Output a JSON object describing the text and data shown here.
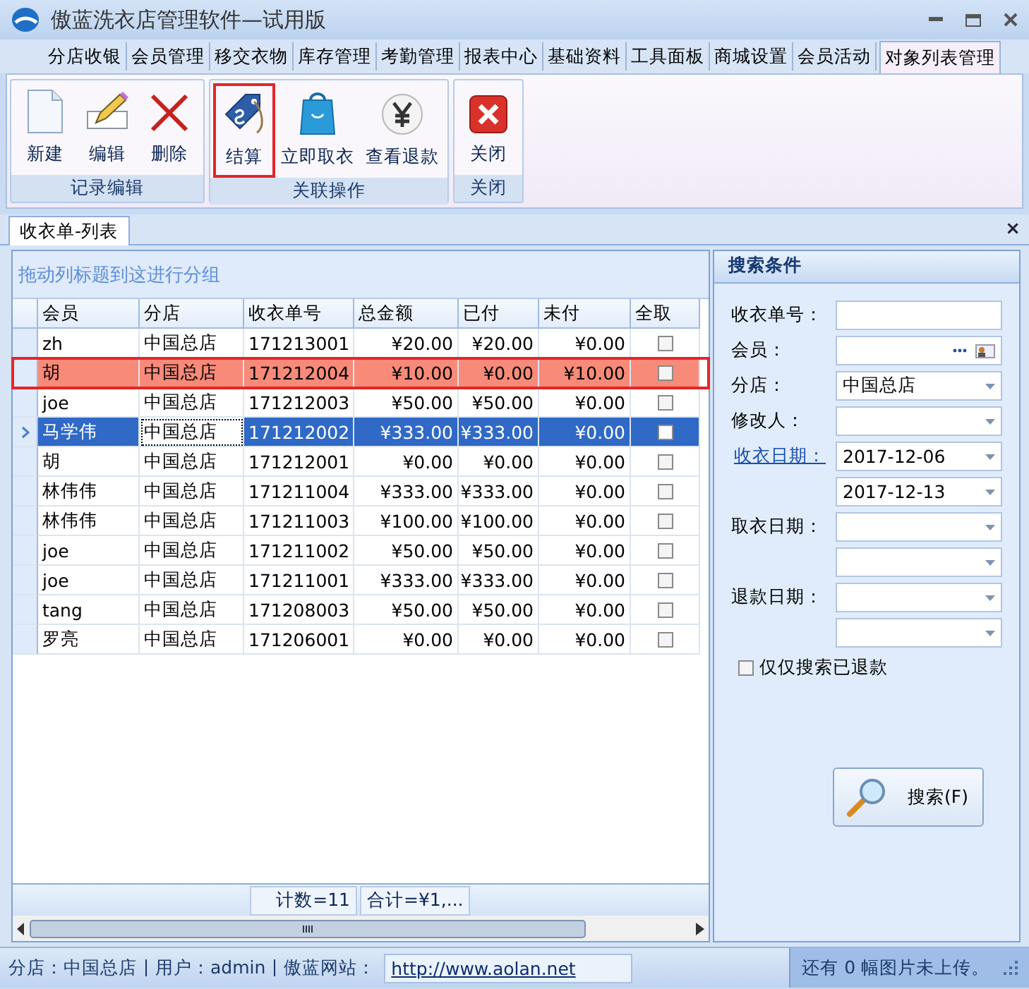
{
  "window": {
    "title": "傲蓝洗衣店管理软件—试用版"
  },
  "menu_tabs": [
    {
      "label": "分店收银",
      "selected": false
    },
    {
      "label": "会员管理",
      "selected": false
    },
    {
      "label": "移交衣物",
      "selected": false
    },
    {
      "label": "库存管理",
      "selected": false
    },
    {
      "label": "考勤管理",
      "selected": false
    },
    {
      "label": "报表中心",
      "selected": false
    },
    {
      "label": "基础资料",
      "selected": false
    },
    {
      "label": "工具面板",
      "selected": false
    },
    {
      "label": "商城设置",
      "selected": false
    },
    {
      "label": "会员活动",
      "selected": false
    },
    {
      "label": "对象列表管理",
      "selected": true
    }
  ],
  "ribbon_groups": [
    {
      "label": "记录编辑",
      "buttons": [
        {
          "label": "新建",
          "kind": "page",
          "highlighted": false
        },
        {
          "label": "编辑",
          "kind": "pencil",
          "highlighted": false
        },
        {
          "label": "删除",
          "kind": "cross",
          "highlighted": false
        }
      ]
    },
    {
      "label": "关联操作",
      "buttons": [
        {
          "label": "结算",
          "kind": "tag",
          "highlighted": true
        },
        {
          "label": "立即取衣",
          "kind": "bag",
          "highlighted": false
        },
        {
          "label": "查看退款",
          "kind": "yen",
          "highlighted": false
        }
      ]
    },
    {
      "label": "关闭",
      "buttons": [
        {
          "label": "关闭",
          "kind": "close",
          "highlighted": false
        }
      ]
    }
  ],
  "document_tabs": [
    {
      "label": "收衣单-列表",
      "selected": true
    }
  ],
  "document_close": "×",
  "grid": {
    "group_hint": "拖动列标题到这进行分组",
    "columns": [
      "会员",
      "分店",
      "收衣单号",
      "总金额",
      "已付",
      "未付",
      "全取"
    ],
    "rows": [
      {
        "cells": [
          "zh",
          "中国总店",
          "171213001",
          "¥20.00",
          "¥20.00",
          "¥0.00"
        ],
        "checked": false,
        "selected": false,
        "flagged": false
      },
      {
        "cells": [
          "胡",
          "中国总店",
          "171212004",
          "¥10.00",
          "¥0.00",
          "¥10.00"
        ],
        "checked": false,
        "selected": false,
        "flagged": true
      },
      {
        "cells": [
          "joe",
          "中国总店",
          "171212003",
          "¥50.00",
          "¥50.00",
          "¥0.00"
        ],
        "checked": false,
        "selected": false,
        "flagged": false
      },
      {
        "cells": [
          "马学伟",
          "中国总店",
          "171212002",
          "¥333.00",
          "¥333.00",
          "¥0.00"
        ],
        "checked": false,
        "selected": true,
        "flagged": false
      },
      {
        "cells": [
          "胡",
          "中国总店",
          "171212001",
          "¥0.00",
          "¥0.00",
          "¥0.00"
        ],
        "checked": false,
        "selected": false,
        "flagged": false
      },
      {
        "cells": [
          "林伟伟",
          "中国总店",
          "171211004",
          "¥333.00",
          "¥333.00",
          "¥0.00"
        ],
        "checked": false,
        "selected": false,
        "flagged": false
      },
      {
        "cells": [
          "林伟伟",
          "中国总店",
          "171211003",
          "¥100.00",
          "¥100.00",
          "¥0.00"
        ],
        "checked": false,
        "selected": false,
        "flagged": false
      },
      {
        "cells": [
          "joe",
          "中国总店",
          "171211002",
          "¥50.00",
          "¥50.00",
          "¥0.00"
        ],
        "checked": false,
        "selected": false,
        "flagged": false
      },
      {
        "cells": [
          "joe",
          "中国总店",
          "171211001",
          "¥333.00",
          "¥333.00",
          "¥0.00"
        ],
        "checked": false,
        "selected": false,
        "flagged": false
      },
      {
        "cells": [
          "tang",
          "中国总店",
          "171208003",
          "¥50.00",
          "¥50.00",
          "¥0.00"
        ],
        "checked": false,
        "selected": false,
        "flagged": false
      },
      {
        "cells": [
          "罗亮",
          "中国总店",
          "171206001",
          "¥0.00",
          "¥0.00",
          "¥0.00"
        ],
        "checked": false,
        "selected": false,
        "flagged": false
      }
    ],
    "summary": [
      "计数=11",
      "合计=¥1,..."
    ]
  },
  "search_panel": {
    "title": "搜索条件",
    "fields": [
      {
        "label": "收衣单号：",
        "kind": "text",
        "link": false
      },
      {
        "label": "会员：",
        "kind": "picker",
        "link": false
      },
      {
        "label": "分店：",
        "kind": "dropdown",
        "value": "中国总店",
        "link": false
      },
      {
        "label": "修改人：",
        "kind": "dropdown",
        "link": false
      },
      {
        "label": "收衣日期：",
        "kind": "dropdown",
        "value": "2017-12-06",
        "link": true
      },
      {
        "kind": "dropdown",
        "value": "2017-12-13"
      },
      {
        "label": "取衣日期：",
        "kind": "dropdown",
        "link": false
      },
      {
        "kind": "dropdown"
      },
      {
        "label": "退款日期：",
        "kind": "dropdown",
        "link": false
      },
      {
        "kind": "dropdown"
      }
    ],
    "refund_only": {
      "label": "仅仅搜索已退款",
      "checked": false
    },
    "search_button": "搜索(F)"
  },
  "status_bar": {
    "items": [
      "分店：中国总店",
      "用户：admin",
      "傲蓝网站："
    ],
    "link": "http://www.aolan.net",
    "upload_note": "还有 0 幅图片未上传。"
  }
}
